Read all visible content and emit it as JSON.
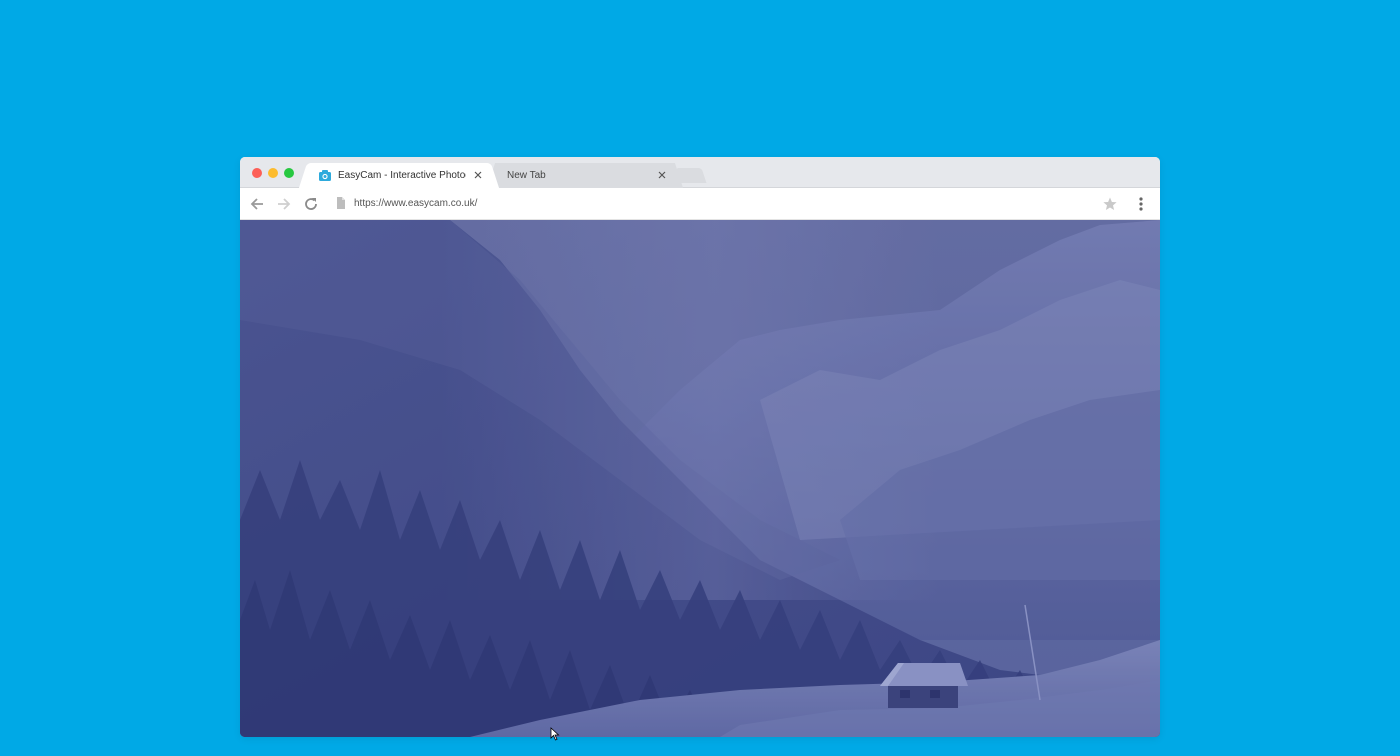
{
  "browser": {
    "tabs": [
      {
        "title": "EasyCam - Interactive Photog...",
        "active": true,
        "favicon": "camera-favicon-icon"
      },
      {
        "title": "New Tab",
        "active": false
      }
    ],
    "address_bar": {
      "url": "https://www.easycam.co.uk/"
    },
    "toolbar_icons": [
      "back-arrow-icon",
      "forward-arrow-icon",
      "reload-icon",
      "page-icon",
      "star-icon",
      "menu-dots-icon"
    ]
  },
  "page": {
    "hero_image": "snowy-mountain-valley-with-cabin"
  },
  "colors": {
    "background": "#00a9e6",
    "overlay": "#4a5694",
    "accent_favicon": "#2eaadc"
  }
}
